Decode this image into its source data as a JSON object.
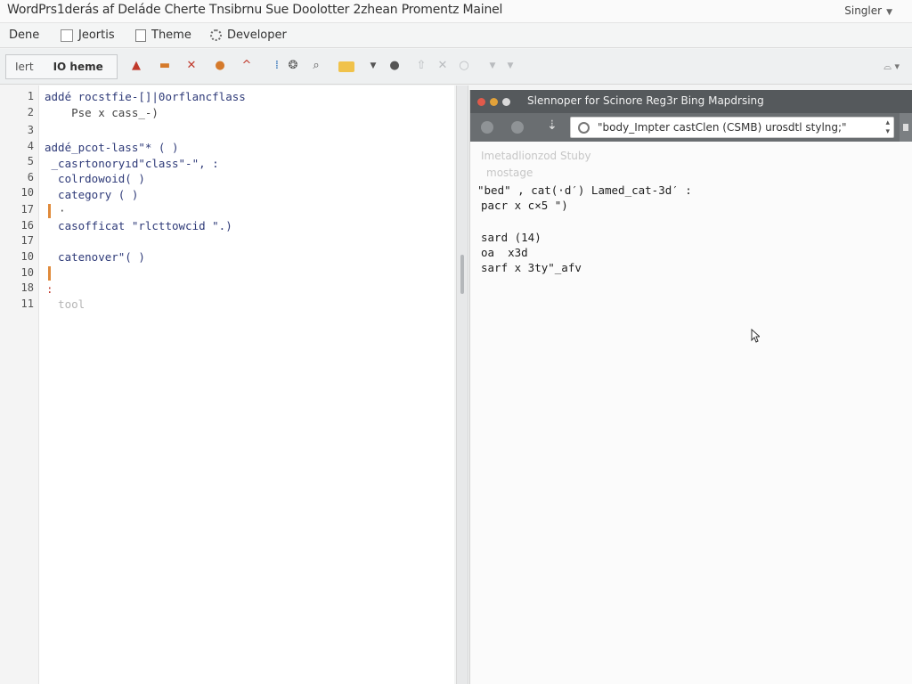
{
  "window": {
    "title": "WordPrs1derás af Deláde Cherte Tnsibrnu Sue Doolotter 2zhean Promentz Mainel",
    "right_label": "Singler"
  },
  "menubar": {
    "items": [
      "Dene",
      "Jeortis",
      "Theme",
      "Developer"
    ]
  },
  "toolbar": {
    "box_left": "Iert",
    "box_right": "IO heme",
    "icons": [
      "pen-icon",
      "ink-icon",
      "cut-icon",
      "shape-icon",
      "caret-icon",
      "pin-icon",
      "gear-icon",
      "search-icon",
      "folder-icon",
      "dropdown-icon",
      "bug-icon",
      "up-icon",
      "close-icon",
      "circle-icon",
      "dropdown-icon",
      "dropdown-icon"
    ],
    "right_icon": "view-icon"
  },
  "editor": {
    "line_numbers": [
      "1",
      "2",
      "3",
      "4",
      "5",
      "6",
      "10",
      "17",
      "16",
      "17",
      "10",
      "10",
      "18",
      "11"
    ],
    "lines": [
      "addé rocstfie-[]|0orflancflass",
      "    Pse x cass_-)",
      "addé_pcot-lass\"* ( )",
      " _casrtonoryıd\"class\"-\", :",
      "  colrdowoid( )",
      "  category ( )",
      "  casofficat \"rlcttowcid \".)",
      "  catenover\"( )",
      "  tool"
    ],
    "marks": [
      "·",
      ":"
    ]
  },
  "preview": {
    "title": "Slennoper for Scinore Reg3r Bing Mapdrsing",
    "url": "\"body_Impter castClen (CSMB) urosdtl stylng;\"",
    "dim_line1": "Imetadlionzod Stuby",
    "dim_line2": "mostage",
    "output": [
      "\"bed\" , cat(·d′) Lamed_cat-3d′ :",
      "pacr x c×5 \")",
      "",
      "sard (14)",
      "oa  x3d",
      "sarf x 3ty\"_afv"
    ]
  },
  "colors": {
    "accent": "#2c6fb8",
    "caret": "#e08a3a",
    "preview_title_bg": "#55595c"
  }
}
